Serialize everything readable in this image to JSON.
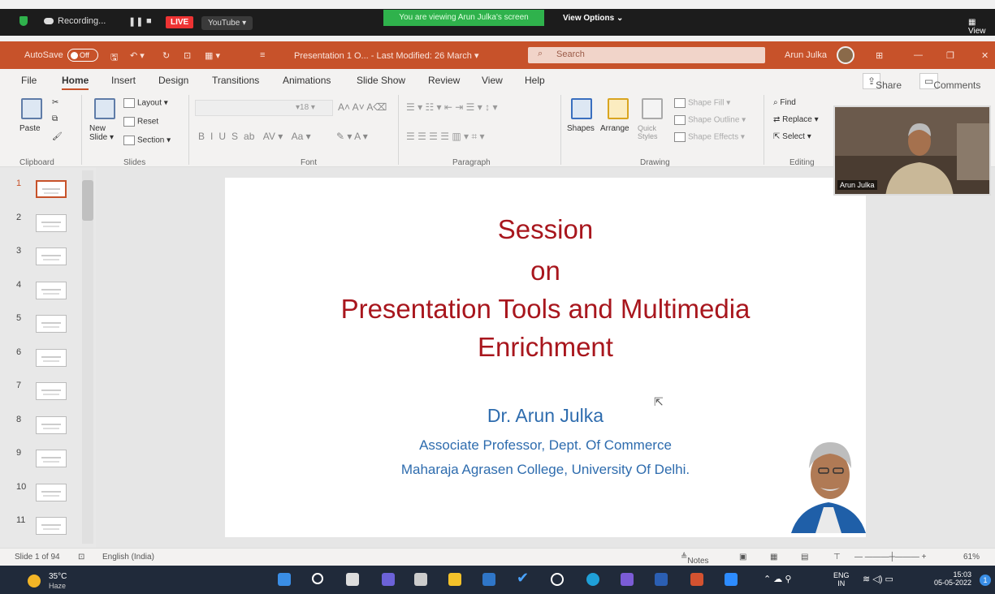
{
  "zoom_bar": {
    "recording": "Recording...",
    "live": "LIVE",
    "youtube": "YouTube ▾",
    "viewing": "You are viewing Arun Julka's screen",
    "view_options": "View Options ⌄",
    "view": "View"
  },
  "title_bar": {
    "autosave": "AutoSave",
    "autosave_state": "Off",
    "file_title": "Presentation 1 O... - Last Modified: 26 March ▾",
    "search_placeholder": "Search",
    "user": "Arun Julka"
  },
  "tabs": [
    "File",
    "Home",
    "Insert",
    "Design",
    "Transitions",
    "Animations",
    "Slide Show",
    "Review",
    "View",
    "Help"
  ],
  "share": "Share",
  "comments": "Comments",
  "ribbon": {
    "clipboard": {
      "paste": "Paste",
      "label": "Clipboard"
    },
    "slides": {
      "new_slide": "New Slide ▾",
      "layout": "Layout ▾",
      "reset": "Reset",
      "section": "Section ▾",
      "label": "Slides"
    },
    "font": {
      "size": "18",
      "label": "Font",
      "buttons": [
        "B",
        "I",
        "U",
        "S",
        "ab",
        "AV ▾",
        "Aa ▾"
      ]
    },
    "paragraph": {
      "label": "Paragraph"
    },
    "drawing": {
      "shapes": "Shapes",
      "arrange": "Arrange",
      "quick_styles": "Quick Styles",
      "shape_fill": "Shape Fill ▾",
      "shape_outline": "Shape Outline ▾",
      "shape_effects": "Shape Effects ▾",
      "label": "Drawing"
    },
    "editing": {
      "find": "Find",
      "replace": "Replace ▾",
      "select": "Select ▾",
      "label": "Editing"
    }
  },
  "slide_numbers": [
    "1",
    "2",
    "3",
    "4",
    "5",
    "6",
    "7",
    "8",
    "9",
    "10",
    "11"
  ],
  "slide": {
    "line1": "Session",
    "line2": "on",
    "line3": "Presentation Tools and Multimedia",
    "line4": "Enrichment",
    "author": "Dr. Arun Julka",
    "position": "Associate Professor, Dept. Of Commerce",
    "college": "Maharaja Agrasen College, University Of Delhi."
  },
  "camera": {
    "name": "Arun Julka"
  },
  "status": {
    "slide": "Slide 1 of 94",
    "language": "English (India)",
    "notes": "Notes",
    "zoom": "61%"
  },
  "taskbar": {
    "temp": "35°C",
    "weather": "Haze",
    "lang1": "ENG",
    "lang2": "IN",
    "time": "15:03",
    "date": "05-05-2022",
    "notif": "1"
  },
  "colors": {
    "accent": "#c7522a",
    "title_red": "#a8161d",
    "text_blue": "#2e6cae"
  }
}
